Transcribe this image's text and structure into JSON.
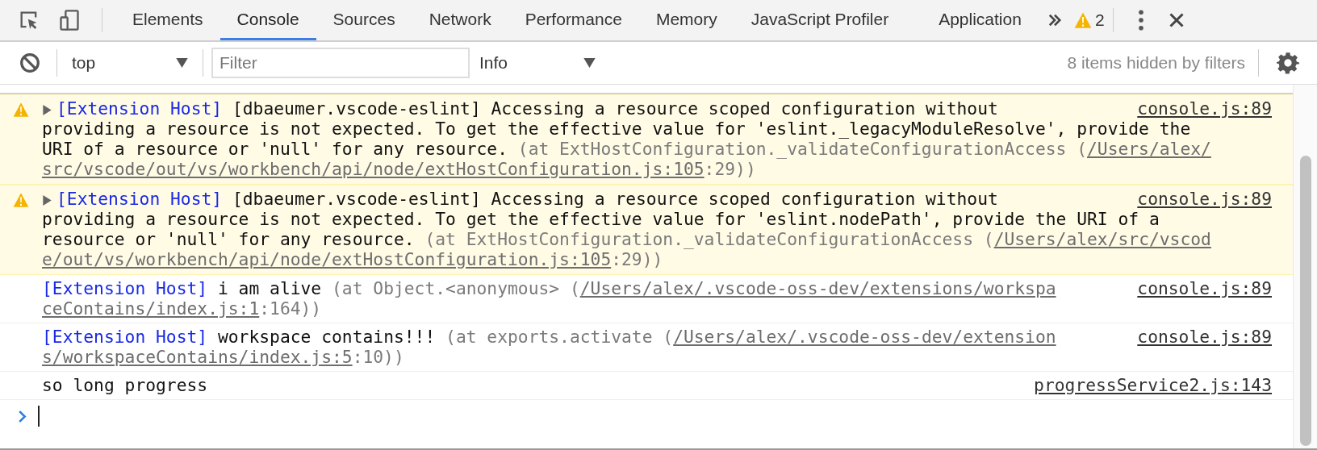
{
  "tabs": [
    {
      "label": "Elements",
      "selected": false
    },
    {
      "label": "Console",
      "selected": true
    },
    {
      "label": "Sources",
      "selected": false
    },
    {
      "label": "Network",
      "selected": false
    },
    {
      "label": "Performance",
      "selected": false
    },
    {
      "label": "Memory",
      "selected": false
    },
    {
      "label": "JavaScript Profiler",
      "selected": false
    },
    {
      "label": "Application",
      "selected": false
    }
  ],
  "warning_count": "2",
  "toolbar": {
    "context": "top",
    "filter": {
      "placeholder": "Filter"
    },
    "level": "Info",
    "hidden_note": "8 items hidden by filters"
  },
  "messages": [
    {
      "kind": "warning",
      "expanded": false,
      "location": "console.js:89",
      "lines": [
        [
          {
            "kind": "source",
            "text": "[Extension Host]"
          },
          {
            "kind": "text",
            "text": " [dbaeumer.vscode-eslint] Accessing a resource scoped configuration without"
          }
        ],
        [
          {
            "kind": "text",
            "text": "providing a resource is not expected. To get the effective value for 'eslint._legacyModuleResolve', provide the"
          }
        ],
        [
          {
            "kind": "text",
            "text": "URI of a resource or 'null' for any resource. "
          },
          {
            "kind": "meta",
            "text": "(at ExtHostConfiguration._validateConfigurationAccess ("
          },
          {
            "kind": "link",
            "text": "/Users/alex/"
          }
        ],
        [
          {
            "kind": "link",
            "text": "src/vscode/out/vs/workbench/api/node/extHostConfiguration.js:105"
          },
          {
            "kind": "meta",
            "text": ":29))"
          }
        ]
      ]
    },
    {
      "kind": "warning",
      "expanded": false,
      "location": "console.js:89",
      "lines": [
        [
          {
            "kind": "source",
            "text": "[Extension Host]"
          },
          {
            "kind": "text",
            "text": " [dbaeumer.vscode-eslint] Accessing a resource scoped configuration without"
          }
        ],
        [
          {
            "kind": "text",
            "text": "providing a resource is not expected. To get the effective value for 'eslint.nodePath', provide the URI of a"
          }
        ],
        [
          {
            "kind": "text",
            "text": "resource or 'null' for any resource. "
          },
          {
            "kind": "meta",
            "text": "(at ExtHostConfiguration._validateConfigurationAccess ("
          },
          {
            "kind": "link",
            "text": "/Users/alex/src/vscod"
          }
        ],
        [
          {
            "kind": "link",
            "text": "e/out/vs/workbench/api/node/extHostConfiguration.js:105"
          },
          {
            "kind": "meta",
            "text": ":29))"
          }
        ]
      ]
    },
    {
      "kind": "log",
      "location": "console.js:89",
      "lines": [
        [
          {
            "kind": "source",
            "text": "[Extension Host]"
          },
          {
            "kind": "text",
            "text": " i am alive "
          },
          {
            "kind": "meta",
            "text": "(at Object.<anonymous> ("
          },
          {
            "kind": "link",
            "text": "/Users/alex/.vscode-oss-dev/extensions/workspa"
          }
        ],
        [
          {
            "kind": "link",
            "text": "ceContains/index.js:1"
          },
          {
            "kind": "meta",
            "text": ":164))"
          }
        ]
      ]
    },
    {
      "kind": "log",
      "location": "console.js:89",
      "lines": [
        [
          {
            "kind": "source",
            "text": "[Extension Host]"
          },
          {
            "kind": "text",
            "text": " workspace contains!!! "
          },
          {
            "kind": "meta",
            "text": "(at exports.activate ("
          },
          {
            "kind": "link",
            "text": "/Users/alex/.vscode-oss-dev/extension"
          }
        ],
        [
          {
            "kind": "link",
            "text": "s/workspaceContains/index.js:5"
          },
          {
            "kind": "meta",
            "text": ":10))"
          }
        ]
      ]
    },
    {
      "kind": "log",
      "location": "progressService2.js:143",
      "lines": [
        [
          {
            "kind": "text",
            "text": "so long progress"
          }
        ]
      ]
    }
  ]
}
